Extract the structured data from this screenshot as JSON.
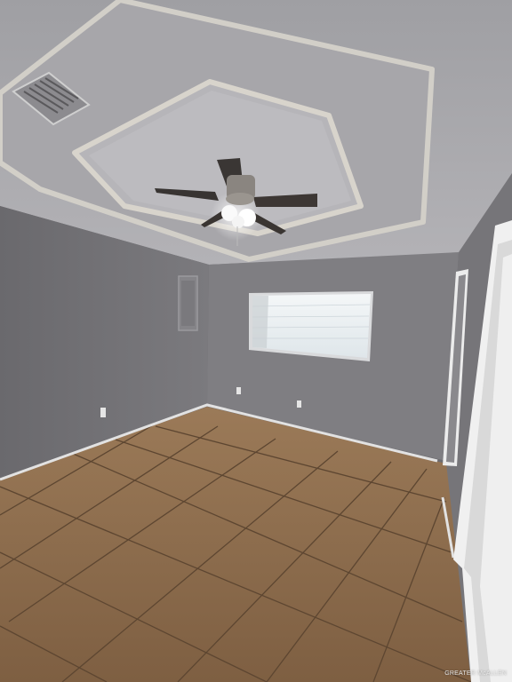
{
  "scene": {
    "colors": {
      "ceiling": "#a9a9ad",
      "ceiling_inner": "#b9b8bc",
      "trim": "#d6d3cc",
      "wall_left": "#737276",
      "wall_back": "#807f83",
      "wall_right": "#79787c",
      "floor": "#8a6a4a",
      "grout": "#5a4430",
      "baseboard": "#dcdcdc",
      "window_blind": "#eef2f4",
      "door_frame": "#e6e6e6",
      "panel": "#7e7d80"
    },
    "icons": [
      "ceiling-fan-icon",
      "air-vent-icon",
      "electrical-panel-icon",
      "outlet-icon"
    ]
  },
  "watermark": {
    "text": "GREATER McALLEN"
  }
}
